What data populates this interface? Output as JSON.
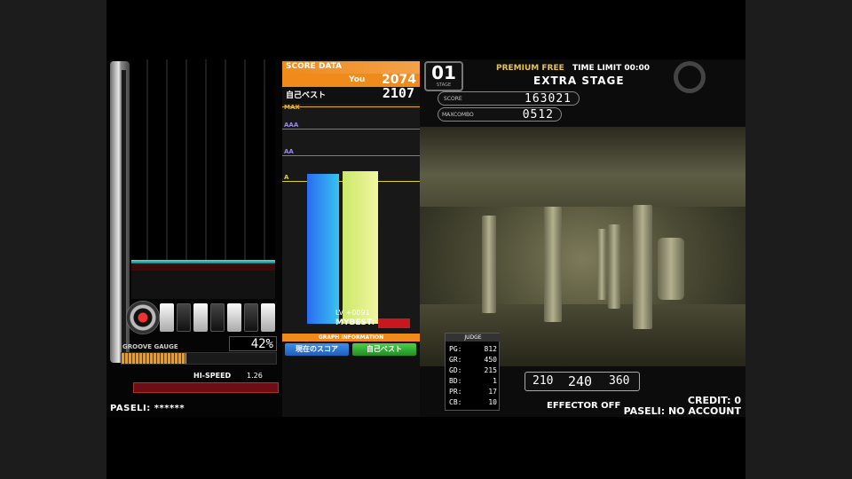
{
  "left_panel": {
    "gauge_label": "GROOVE GAUGE",
    "gauge_percent": 42,
    "gauge_value_text": "42%",
    "hi_speed_label": "HI-SPEED",
    "hi_speed_value": "1.26",
    "paseli": "PASELI: ******"
  },
  "score_panel": {
    "header": "SCORE DATA",
    "you_label": "You",
    "you_score": "2074",
    "best_label": "自己ベスト",
    "best_score": "2107",
    "grade_labels": [
      "MAX",
      "AAA",
      "AA",
      "A"
    ],
    "bars": [
      {
        "name": "you",
        "color": "#2a8ff0",
        "value": 2074
      },
      {
        "name": "best",
        "color": "#e4f28a",
        "value": 2107
      }
    ],
    "graph_max": 2800,
    "diff_text": "LV +0091",
    "mybest_label": "MYBEST:",
    "graph_info": "GRAPH INFORMATION",
    "btn_left": "現在のスコア",
    "btn_right": "自己ベスト"
  },
  "header": {
    "stage_number": "01",
    "stage_sub": "STAGE",
    "premium_free": "PREMIUM FREE",
    "time_limit": "TIME LIMIT 00:00",
    "extra_stage": "EXTRA STAGE",
    "score_label": "SCORE",
    "score_value": "163021",
    "maxcombo_label": "MAXCOMBO",
    "maxcombo_value": "0512"
  },
  "judge": {
    "title": "JUDGE",
    "rows": [
      {
        "k": "PG:",
        "v": "812"
      },
      {
        "k": "GR:",
        "v": "450"
      },
      {
        "k": "GD:",
        "v": "215"
      },
      {
        "k": "BD:",
        "v": "1"
      },
      {
        "k": "PR:",
        "v": "17"
      },
      {
        "k": "CB:",
        "v": "10"
      }
    ]
  },
  "bpm": {
    "min": "210",
    "current": "240",
    "max": "360"
  },
  "footer": {
    "effector": "EFFECTOR OFF",
    "credit": "CREDIT: 0",
    "paseli": "PASELI: NO ACCOUNT"
  }
}
